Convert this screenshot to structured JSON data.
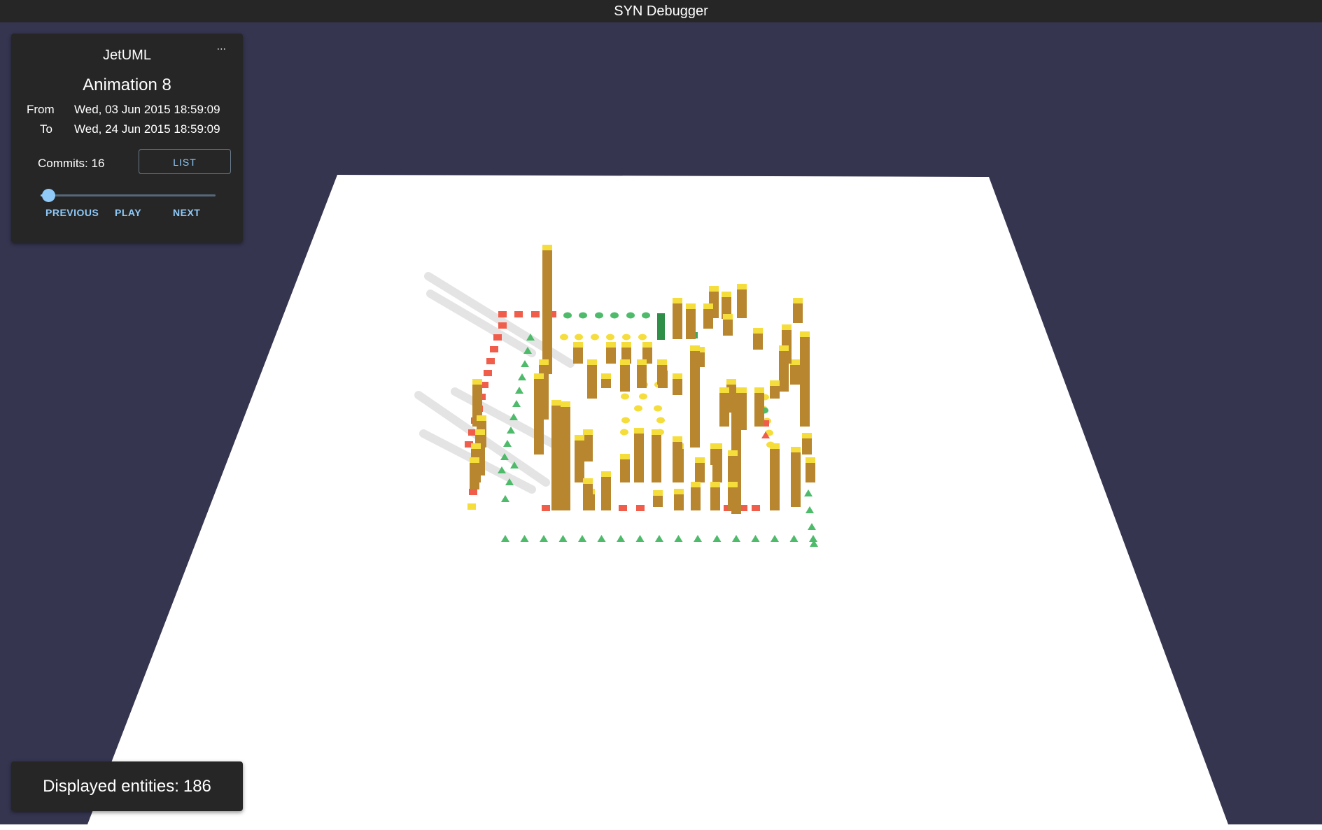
{
  "window": {
    "title": "SYN Debugger"
  },
  "panel": {
    "project": "JetUML",
    "menu_label": "...",
    "animation": "Animation 8",
    "from_label": "From",
    "from_value": "Wed, 03 Jun 2015 18:59:09",
    "to_label": "To",
    "to_value": "Wed, 24 Jun 2015 18:59:09",
    "commits_label": "Commits:",
    "commits_count": "16",
    "list_button": "LIST",
    "previous_button": "PREVIOUS",
    "play_button": "PLAY",
    "next_button": "NEXT",
    "slider_progress": 0.05
  },
  "status": {
    "label": "Displayed entities:",
    "count": "186"
  },
  "colors": {
    "background": "#353550",
    "titlebar": "#262626",
    "panel": "#262626",
    "accent": "#90caf9",
    "bar_side": "#b8862e",
    "bar_top": "#f5dd3c",
    "red": "#f05d4a",
    "green": "#4dbb6a",
    "yellow": "#f5dd3c",
    "plane": "#ffffff"
  }
}
